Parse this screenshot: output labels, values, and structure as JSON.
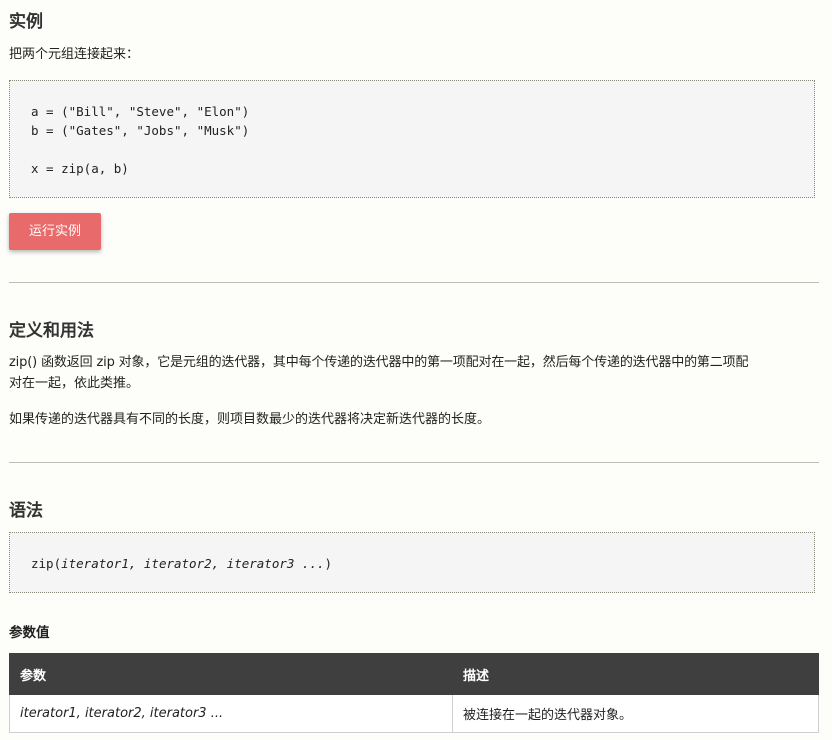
{
  "example": {
    "heading": "实例",
    "intro": "把两个元组连接起来：",
    "code_lines": [
      "a = (\"Bill\", \"Steve\", \"Elon\")",
      "b = (\"Gates\", \"Jobs\", \"Musk\")",
      "",
      "x = zip(a, b)"
    ],
    "run_button": "运行实例"
  },
  "definition": {
    "heading": "定义和用法",
    "para1_line1": "zip() 函数返回 zip 对象，它是元组的迭代器，其中每个传递的迭代器中的第一项配对在一起，然后每个传递的迭代器中的第二项配",
    "para1_line2": "对在一起，依此类推。",
    "para2": "如果传递的迭代器具有不同的长度，则项目数最少的迭代器将决定新迭代器的长度。"
  },
  "syntax": {
    "heading": "语法",
    "code_prefix": "zip(",
    "code_params": "iterator1, iterator2, iterator3 ...",
    "code_suffix": ")"
  },
  "parameters": {
    "heading": "参数值",
    "columns": [
      "参数",
      "描述"
    ],
    "rows": [
      {
        "param": "iterator1, iterator2, iterator3 ...",
        "desc": "被连接在一起的迭代器对象。"
      }
    ]
  },
  "colors": {
    "run_button": "#e86a6a",
    "table_header": "#3f3f3f",
    "code_bg": "#f5f5f5"
  }
}
